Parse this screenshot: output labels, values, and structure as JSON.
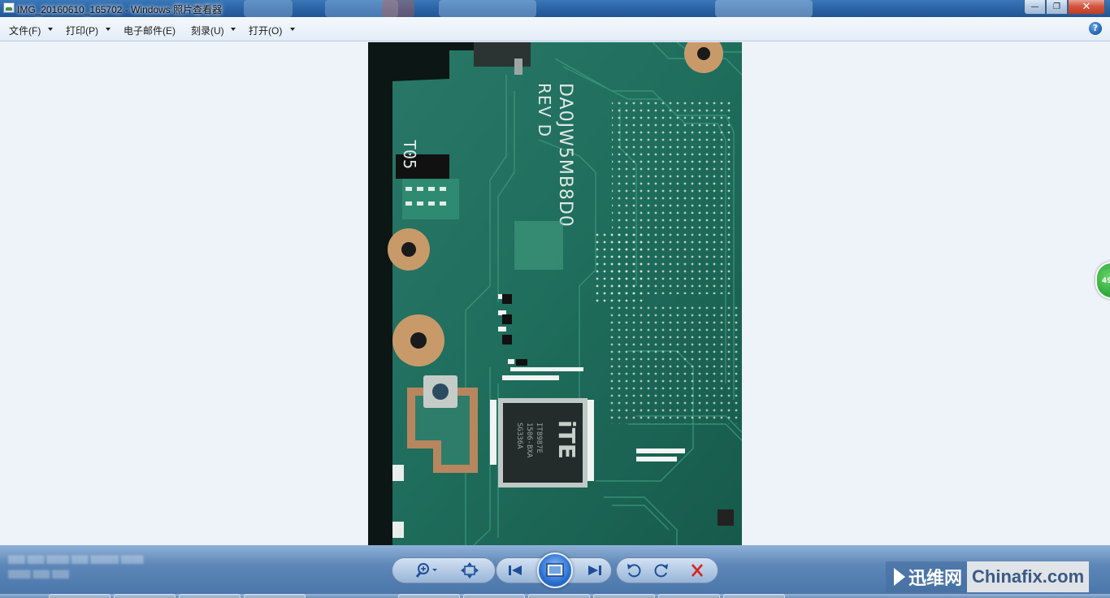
{
  "window": {
    "title": "IMG_20160610_165702 - Windows 照片查看器",
    "minimize_glyph": "—",
    "restore_glyph": "❐",
    "close_glyph": "✕"
  },
  "menu": {
    "items": [
      {
        "label": "文件(F)",
        "has_dropdown": true
      },
      {
        "label": "打印(P)",
        "has_dropdown": true
      },
      {
        "label": "电子邮件(E)",
        "has_dropdown": false
      },
      {
        "label": "刻录(U)",
        "has_dropdown": true
      },
      {
        "label": "打开(O)",
        "has_dropdown": true
      }
    ],
    "help_glyph": "?"
  },
  "photo": {
    "board_label": "DA0JW5MB8D0",
    "board_rev": "REV D",
    "silk_label": "T05",
    "chip_brand": "iTE",
    "chip_line1": "IT8987E",
    "chip_line2": "1506-BXA",
    "chip_line3": "SG336A",
    "colors": {
      "board": "#1f6d5c",
      "trace": "#3d9a7e",
      "pad": "#c89a6a"
    }
  },
  "side_badge": {
    "text": "49"
  },
  "controls": {
    "icons": [
      "zoom-icon",
      "fit-window-icon",
      "previous-icon",
      "slideshow-icon",
      "next-icon",
      "rotate-counterclockwise-icon",
      "rotate-clockwise-icon",
      "delete-icon"
    ],
    "delete_color": "#d9251d"
  },
  "watermark": {
    "left": "迅维网",
    "right": "Chinafix.com"
  }
}
